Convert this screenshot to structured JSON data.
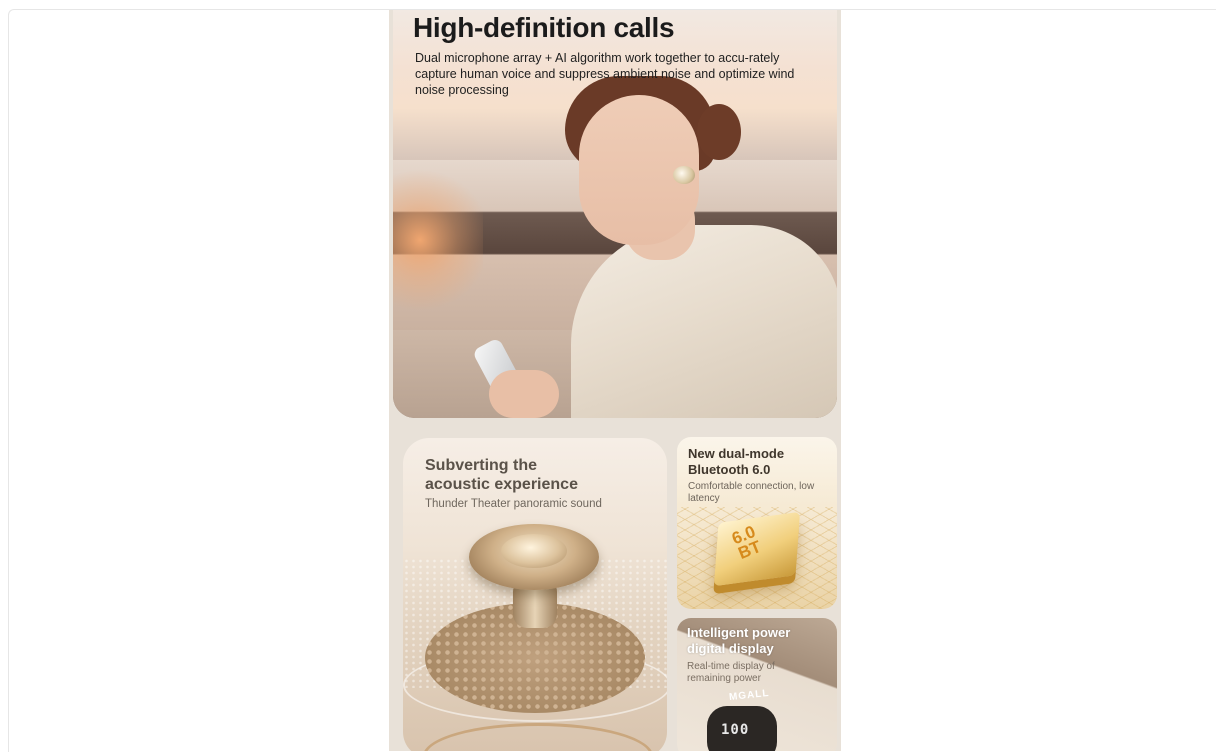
{
  "hero": {
    "title": "High-definition calls",
    "description": "Dual microphone array + AI algorithm work together to accu-rately capture human voice and suppress ambient noise and optimize wind noise processing"
  },
  "features": {
    "acoustic": {
      "title_line1": "Subverting the",
      "title_line2": "acoustic experience",
      "subtitle": "Thunder Theater panoramic sound"
    },
    "bluetooth": {
      "title_line1": "New dual-mode",
      "title_line2": "Bluetooth 6.0",
      "subtitle": "Comfortable connection, low latency",
      "chip_version": "6.0",
      "chip_tag": "BT"
    },
    "power": {
      "title_line1": "Intelligent power",
      "title_line2": "digital display",
      "subtitle": "Real-time display of remaining power",
      "brand": "MGALL",
      "battery_value": "100"
    }
  },
  "colors": {
    "page_background": "#ffffff",
    "poster_background": "#e8e1d8",
    "title_text": "#1b1b1b",
    "gold_accent": "#d68a1c"
  }
}
